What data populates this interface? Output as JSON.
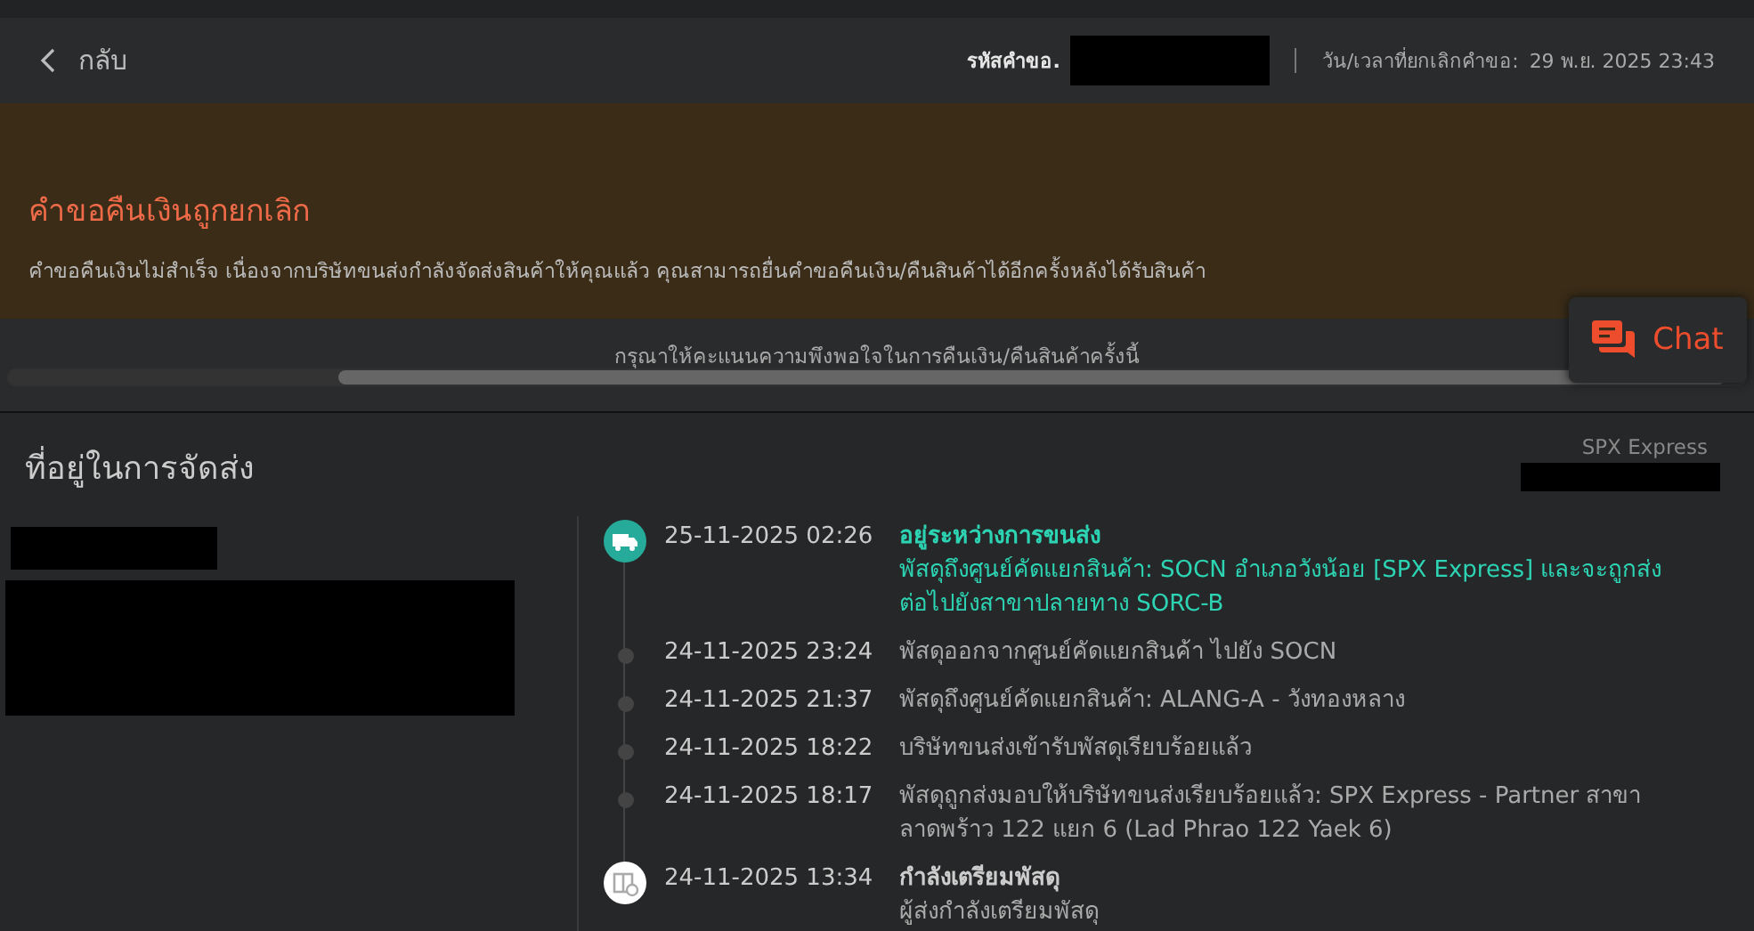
{
  "header": {
    "back_label": "กลับ",
    "request_id_label": "รหัสคำขอ.",
    "cancel_time_label": "วัน/เวลาที่ยกเลิกคำขอ:",
    "cancel_time": "29 พ.ย. 2025 23:43"
  },
  "banner": {
    "title": "คำขอคืนเงินถูกยกเลิก",
    "message": "คำขอคืนเงินไม่สำเร็จ เนื่องจากบริษัทขนส่งกำลังจัดส่งสินค้าให้คุณแล้ว คุณสามารถยื่นคำขอคืนเงิน/คืนสินค้าได้อีกครั้งหลังได้รับสินค้า"
  },
  "rating_prompt": "กรุณาให้คะแนนความพึงพอใจในการคืนเงิน/คืนสินค้าครั้งนี้",
  "chat_button": {
    "label": "Chat"
  },
  "shipping": {
    "title": "ที่อยู่ในการจัดส่ง",
    "carrier": "SPX Express",
    "events": [
      {
        "kind": "transit",
        "time": "25-11-2025 02:26",
        "title": "อยู่ระหว่างการขนส่ง",
        "description": "พัสดุถึงศูนย์คัดแยกสินค้า: SOCN อำเภอวังน้อย [SPX Express] และจะถูกส่งต่อไปยังสาขาปลายทาง SORC-B"
      },
      {
        "kind": "step",
        "time": "24-11-2025 23:24",
        "description": "พัสดุออกจากศูนย์คัดแยกสินค้า ไปยัง SOCN"
      },
      {
        "kind": "step",
        "time": "24-11-2025 21:37",
        "description": "พัสดุถึงศูนย์คัดแยกสินค้า: ALANG-A - วังทองหลาง"
      },
      {
        "kind": "step",
        "time": "24-11-2025 18:22",
        "description": "บริษัทขนส่งเข้ารับพัสดุเรียบร้อยแล้ว"
      },
      {
        "kind": "step",
        "time": "24-11-2025 18:17",
        "description": "พัสดุถูกส่งมอบให้บริษัทขนส่งเรียบร้อยแล้ว: SPX Express - Partner สาขา ลาดพร้าว 122 แยก 6 (Lad Phrao 122 Yaek 6)"
      },
      {
        "kind": "preparing",
        "time": "24-11-2025 13:34",
        "title": "กำลังเตรียมพัสดุ",
        "description": "ผู้ส่งกำลังเตรียมพัสดุ"
      }
    ]
  }
}
